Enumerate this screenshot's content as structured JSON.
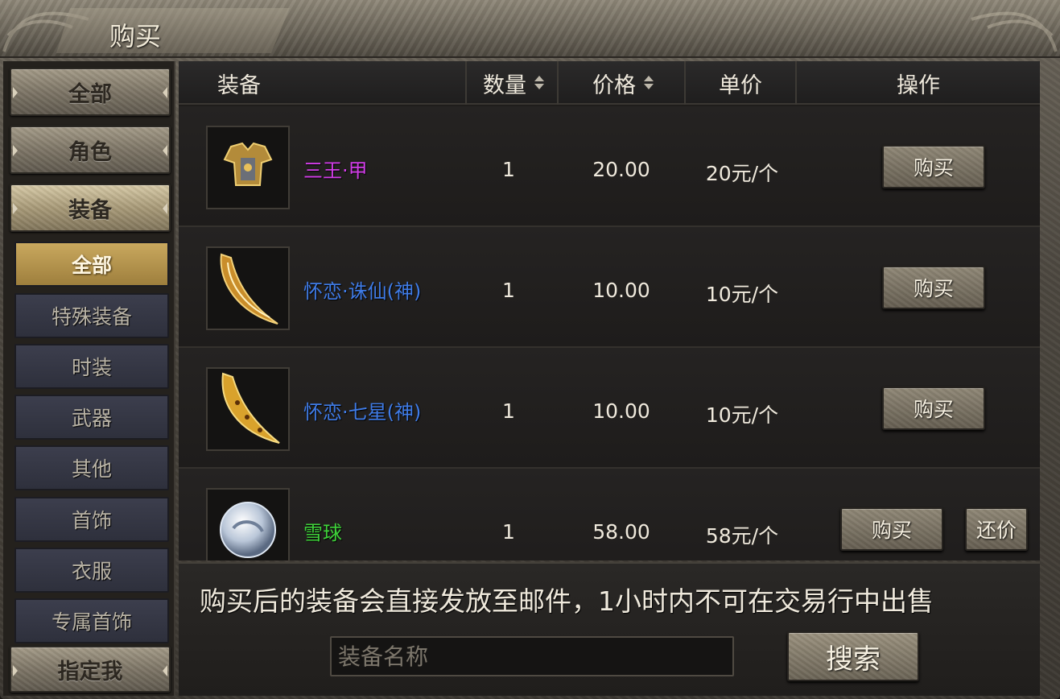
{
  "window": {
    "title": "购买"
  },
  "sidebar": {
    "categories": [
      {
        "label": "全部",
        "icon": "chevron-icon"
      },
      {
        "label": "角色",
        "icon": "chevron-icon"
      },
      {
        "label": "装备",
        "icon": "chevron-icon",
        "active": true
      }
    ],
    "subcategories": [
      {
        "label": "全部",
        "active": true
      },
      {
        "label": "特殊装备"
      },
      {
        "label": "时装"
      },
      {
        "label": "武器"
      },
      {
        "label": "其他"
      },
      {
        "label": "首饰"
      },
      {
        "label": "衣服"
      },
      {
        "label": "专属首饰"
      }
    ],
    "bottom_category": {
      "label": "指定我"
    }
  },
  "table": {
    "headers": {
      "item": "装备",
      "quantity": "数量",
      "price": "价格",
      "unit_price": "单价",
      "action": "操作"
    },
    "rows": [
      {
        "icon": "armor-icon",
        "name": "三王·甲",
        "name_color": "#d23de8",
        "quantity": "1",
        "price": "20.00",
        "unit_price": "20元/个",
        "buy_label": "购买"
      },
      {
        "icon": "blade-icon",
        "name": "怀恋·诛仙(神)",
        "name_color": "#3f7be6",
        "quantity": "1",
        "price": "10.00",
        "unit_price": "10元/个",
        "buy_label": "购买"
      },
      {
        "icon": "blade-icon",
        "name": "怀恋·七星(神)",
        "name_color": "#3f7be6",
        "quantity": "1",
        "price": "10.00",
        "unit_price": "10元/个",
        "buy_label": "购买"
      },
      {
        "icon": "snowball-icon",
        "name": "雪球",
        "name_color": "#3fd23a",
        "quantity": "1",
        "price": "58.00",
        "unit_price": "58元/个",
        "buy_label": "购买",
        "haggle_label": "还价"
      }
    ]
  },
  "footer": {
    "notice": "购买后的装备会直接发放至邮件，1小时内不可在交易行中出售",
    "search_placeholder": "装备名称",
    "search_value": "",
    "search_label": "搜索"
  }
}
